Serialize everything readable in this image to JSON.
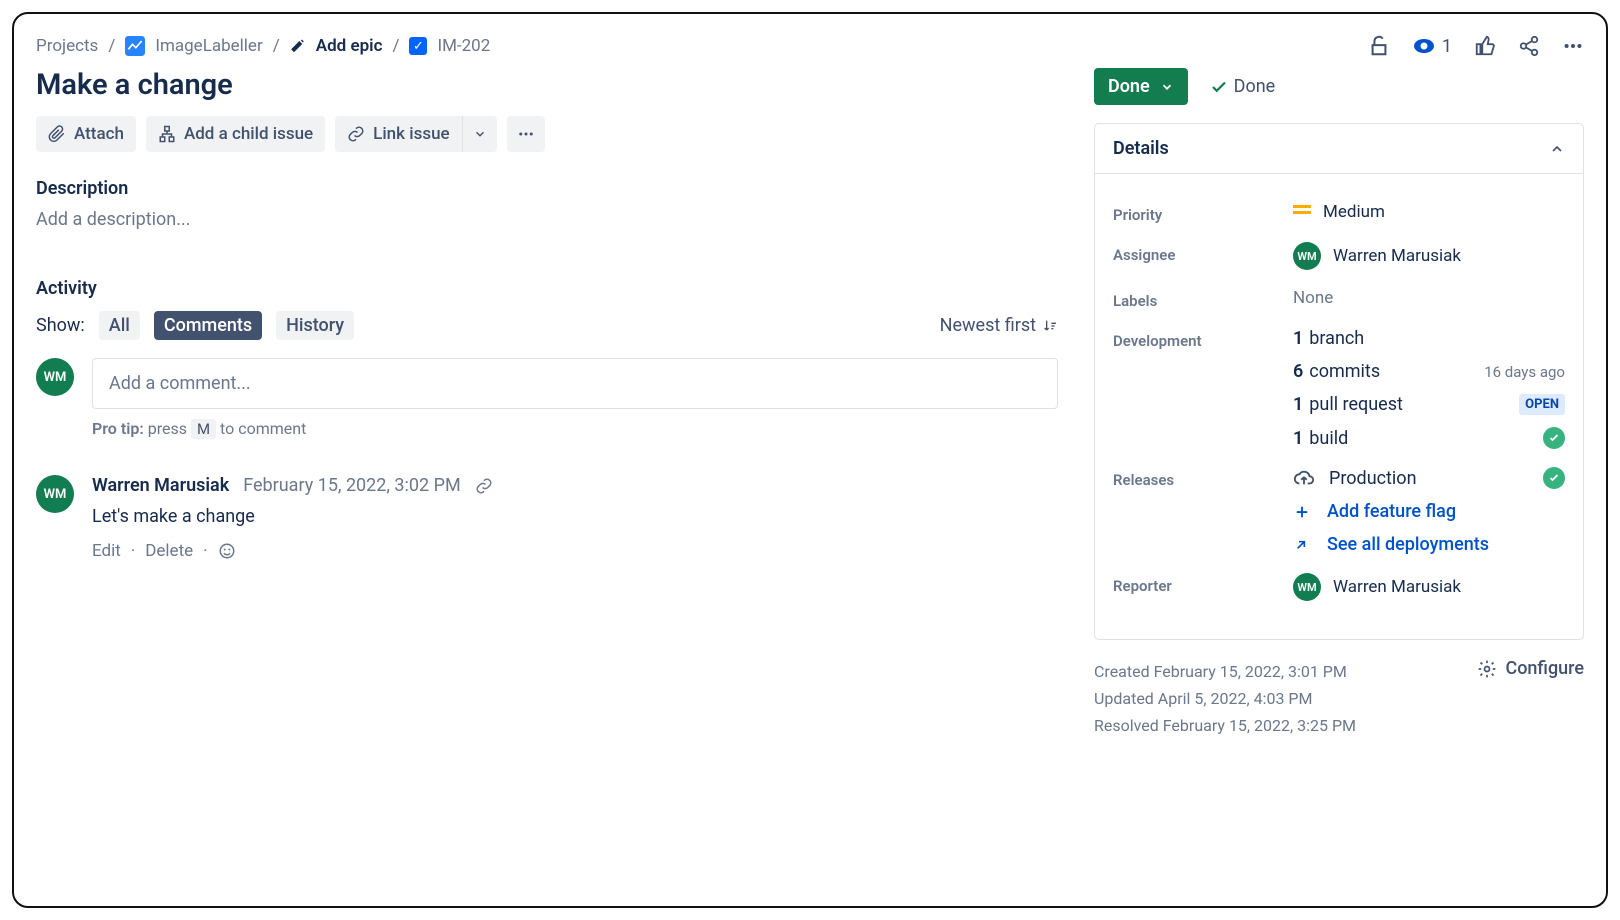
{
  "breadcrumb": {
    "projects": "Projects",
    "project_name": "ImageLabeller",
    "add_epic": "Add epic",
    "issue_key": "IM-202"
  },
  "title": "Make a change",
  "watchers_count": "1",
  "actions": {
    "attach": "Attach",
    "add_child": "Add a child issue",
    "link_issue": "Link issue"
  },
  "description": {
    "label": "Description",
    "placeholder": "Add a description..."
  },
  "activity": {
    "label": "Activity",
    "show": "Show:",
    "tab_all": "All",
    "tab_comments": "Comments",
    "tab_history": "History",
    "sort": "Newest first"
  },
  "comment_box": {
    "avatar_initials": "WM",
    "placeholder": "Add a comment...",
    "protip_label": "Pro tip:",
    "protip_before": " press ",
    "protip_key": "M",
    "protip_after": " to comment"
  },
  "comment": {
    "avatar_initials": "WM",
    "author": "Warren Marusiak",
    "date": "February 15, 2022, 3:02 PM",
    "text": "Let's make a change",
    "edit": "Edit",
    "delete": "Delete"
  },
  "status": {
    "button": "Done",
    "indicator": "Done"
  },
  "details": {
    "header": "Details",
    "priority_label": "Priority",
    "priority_value": "Medium",
    "assignee_label": "Assignee",
    "assignee_value": "Warren Marusiak",
    "assignee_initials": "WM",
    "labels_label": "Labels",
    "labels_value": "None",
    "dev_label": "Development",
    "dev_branch_count": "1",
    "dev_branch_label": "branch",
    "dev_commits_count": "6",
    "dev_commits_label": "commits",
    "dev_commits_meta": "16 days ago",
    "dev_pr_count": "1",
    "dev_pr_label": "pull request",
    "dev_pr_badge": "OPEN",
    "dev_build_count": "1",
    "dev_build_label": "build",
    "releases_label": "Releases",
    "releases_env": "Production",
    "add_flag": "Add feature flag",
    "see_deploy": "See all deployments",
    "reporter_label": "Reporter",
    "reporter_value": "Warren Marusiak",
    "reporter_initials": "WM"
  },
  "meta": {
    "created": "Created February 15, 2022, 3:01 PM",
    "updated": "Updated April 5, 2022, 4:03 PM",
    "resolved": "Resolved February 15, 2022, 3:25 PM",
    "configure": "Configure"
  }
}
